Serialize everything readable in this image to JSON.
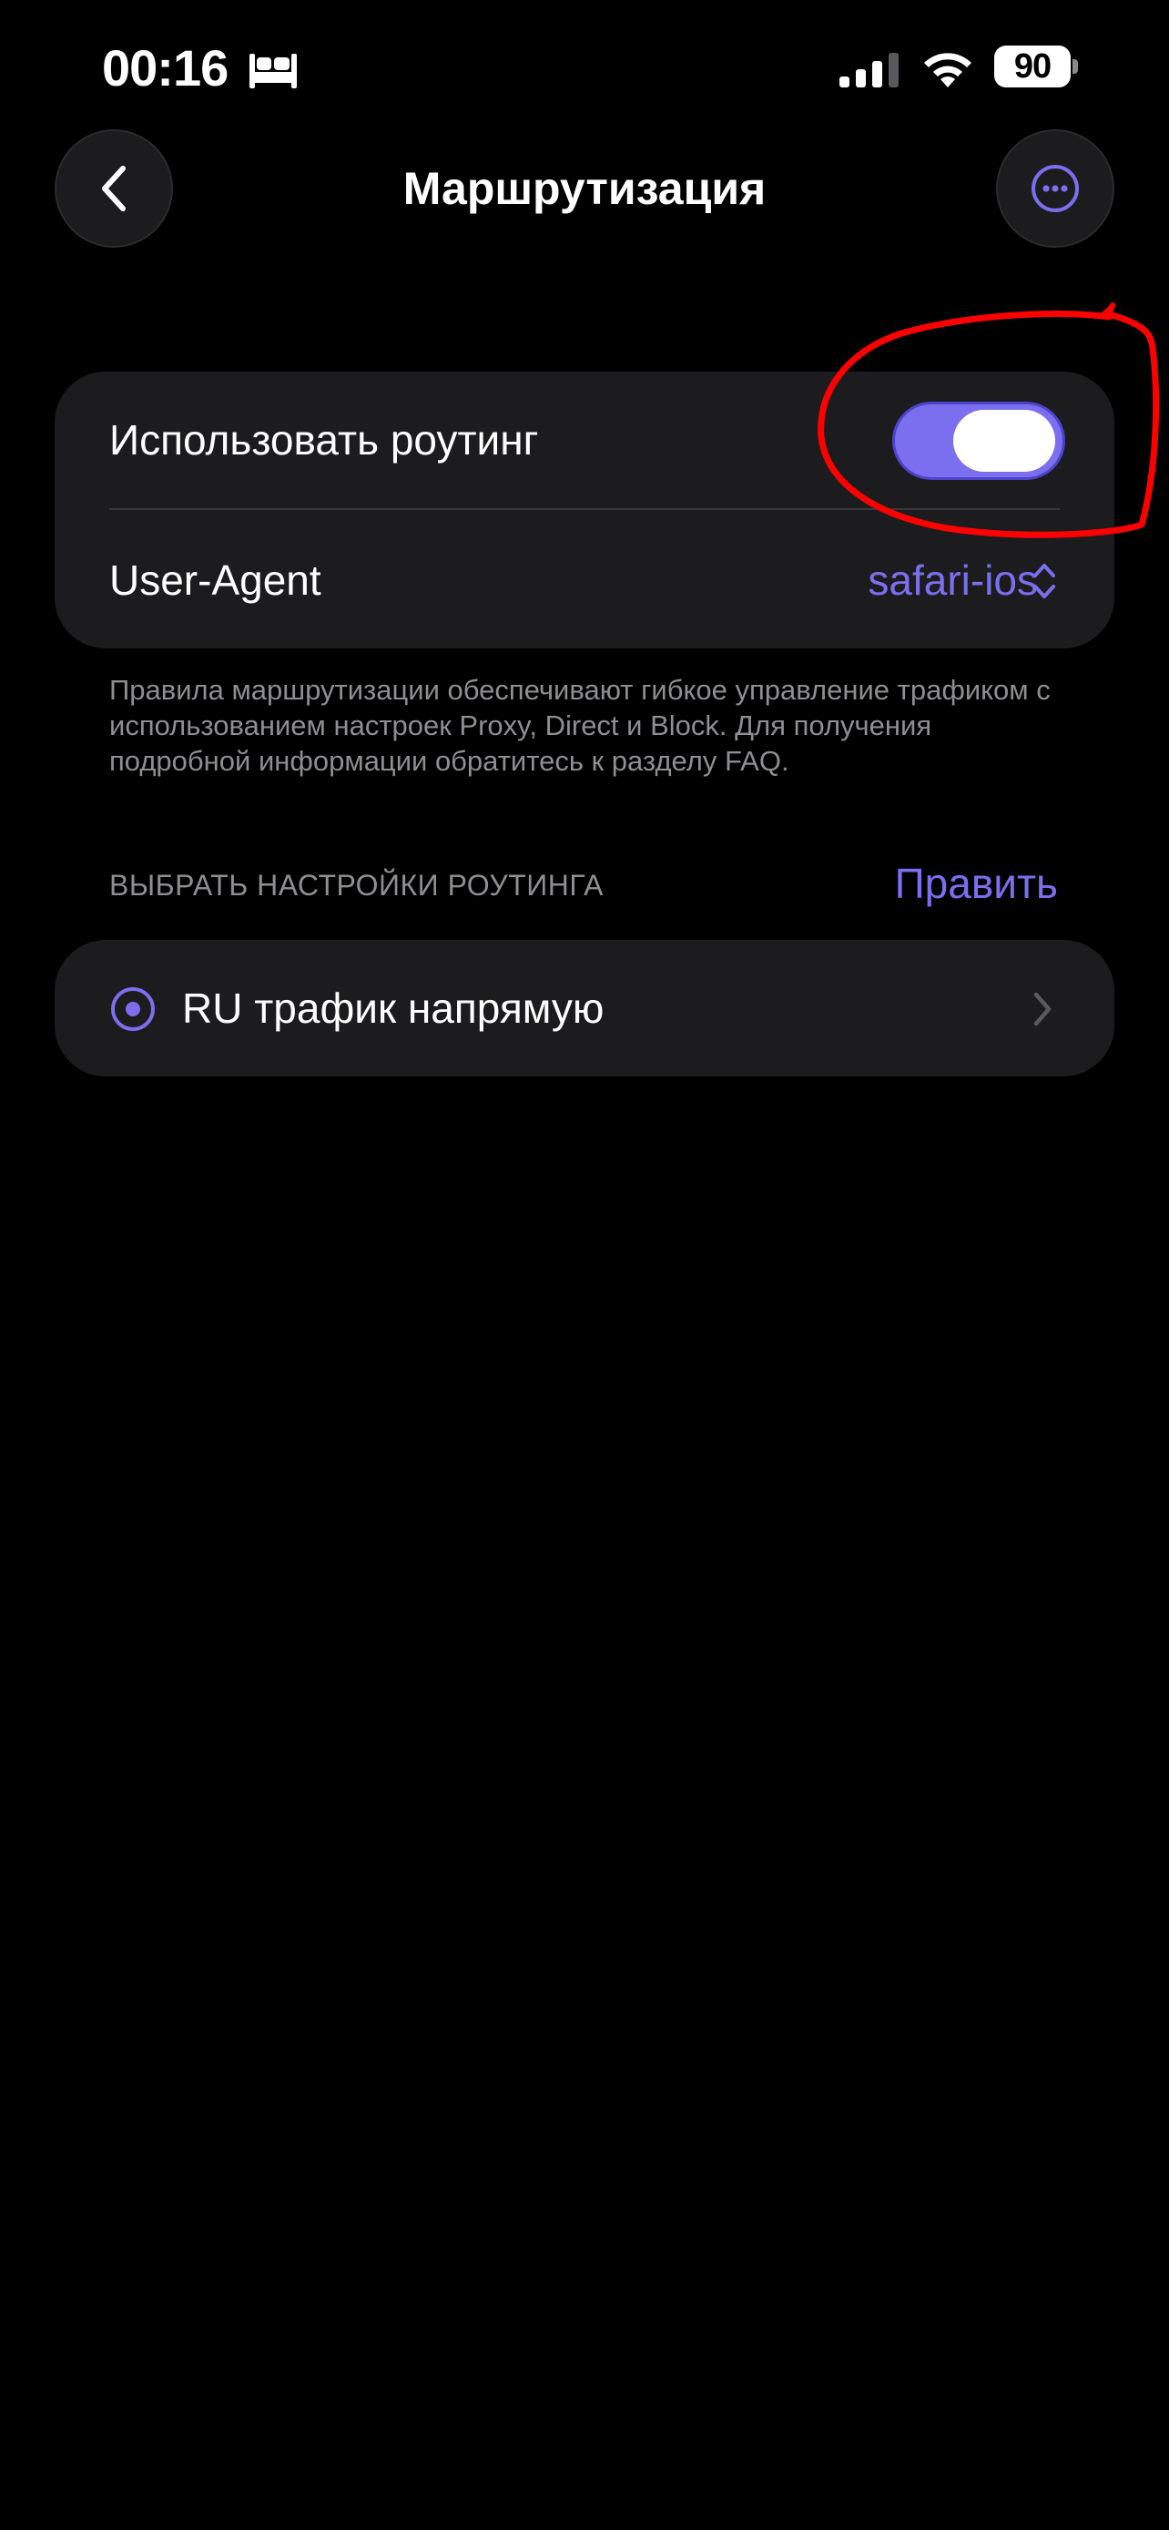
{
  "status_bar": {
    "time": "00:16",
    "battery": "90",
    "icons": [
      "bed-icon",
      "signal-icon",
      "wifi-icon",
      "battery-icon"
    ]
  },
  "header": {
    "title": "Маршрутизация",
    "back_icon": "chevron-left-icon",
    "more_icon": "ellipsis-circle-icon"
  },
  "settings": {
    "use_routing_label": "Использовать роутинг",
    "use_routing_enabled": true,
    "user_agent_label": "User-Agent",
    "user_agent_value": "safari-ios"
  },
  "footnote": "Правила маршрутизации обеспечивают гибкое управление трафиком с использованием настроек Proxy, Direct и Block. Для получения подробной информации обратитесь к разделу FAQ.",
  "routing_section": {
    "header": "ВЫБРАТЬ НАСТРОЙКИ РОУТИНГА",
    "edit_label": "Править",
    "profiles": [
      {
        "label": "RU трафик напрямую",
        "selected": true
      }
    ]
  },
  "colors": {
    "accent": "#7b6ff0",
    "background": "#000000",
    "card": "#1c1c1e",
    "secondary_text": "#8e8e93",
    "annotation": "#ff0000"
  }
}
